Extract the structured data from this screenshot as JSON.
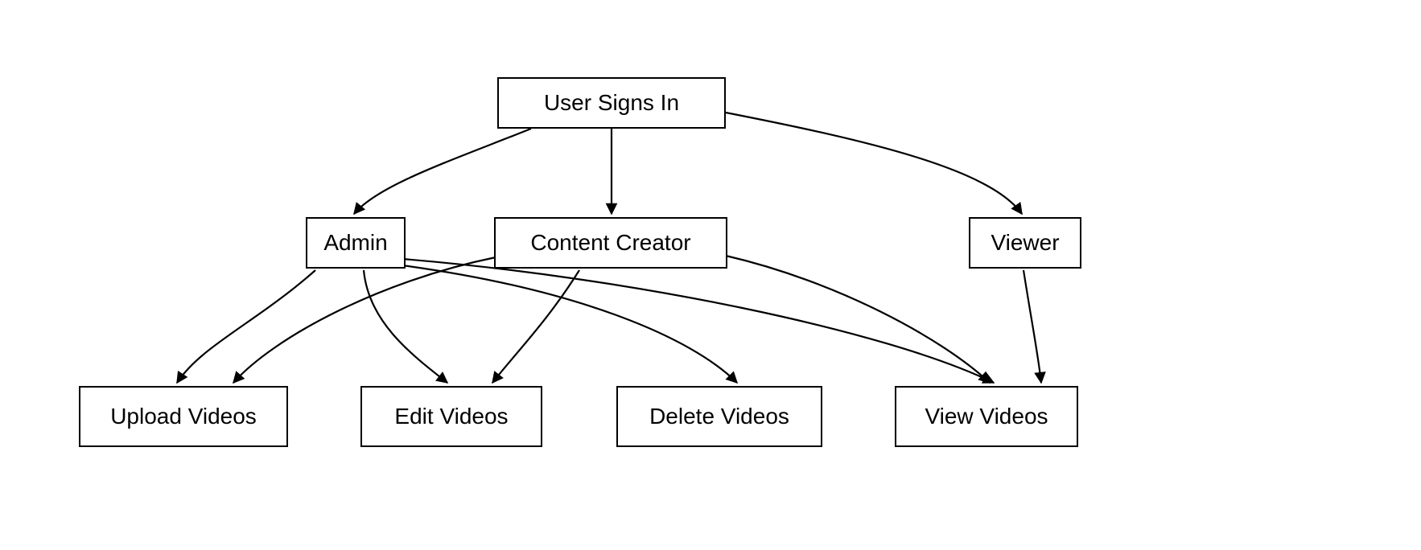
{
  "diagram": {
    "root": {
      "label": "User Signs In"
    },
    "roles": {
      "admin": {
        "label": "Admin"
      },
      "creator": {
        "label": "Content Creator"
      },
      "viewer": {
        "label": "Viewer"
      }
    },
    "actions": {
      "upload": {
        "label": "Upload Videos"
      },
      "edit": {
        "label": "Edit Videos"
      },
      "delete": {
        "label": "Delete Videos"
      },
      "view": {
        "label": "View Videos"
      }
    },
    "edges": [
      {
        "from": "root",
        "to": "admin"
      },
      {
        "from": "root",
        "to": "creator"
      },
      {
        "from": "root",
        "to": "viewer"
      },
      {
        "from": "admin",
        "to": "upload"
      },
      {
        "from": "admin",
        "to": "edit"
      },
      {
        "from": "admin",
        "to": "delete"
      },
      {
        "from": "admin",
        "to": "view"
      },
      {
        "from": "creator",
        "to": "upload"
      },
      {
        "from": "creator",
        "to": "edit"
      },
      {
        "from": "creator",
        "to": "view"
      },
      {
        "from": "viewer",
        "to": "view"
      }
    ]
  }
}
